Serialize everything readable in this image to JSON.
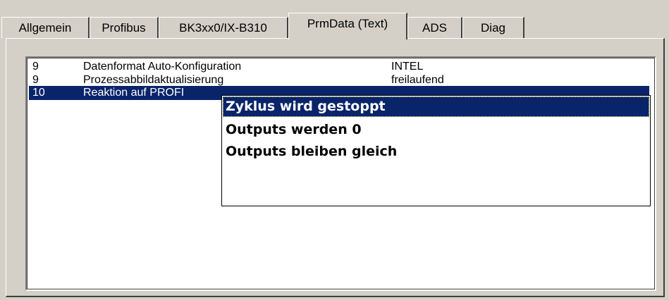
{
  "tabs": [
    {
      "label": "Allgemein"
    },
    {
      "label": "Profibus"
    },
    {
      "label": "BK3xx0/IX-B310"
    },
    {
      "label": "PrmData (Text)"
    },
    {
      "label": "ADS"
    },
    {
      "label": "Diag"
    }
  ],
  "active_tab": "PrmData (Text)",
  "list": {
    "rows": [
      {
        "num": "9",
        "name": "Datenformat Auto-Konfiguration",
        "value": "INTEL"
      },
      {
        "num": "9",
        "name": "Prozessabbildaktualisierung",
        "value": "freilaufend"
      },
      {
        "num": "10",
        "name": "Reaktion auf PROFI",
        "value": ""
      }
    ]
  },
  "dropdown": {
    "options": [
      {
        "label": "Zyklus wird gestoppt"
      },
      {
        "label": "Outputs werden 0"
      },
      {
        "label": "Outputs bleiben gleich"
      }
    ],
    "selected": "Zyklus wird gestoppt"
  },
  "colors": {
    "selection": "#0a246a",
    "window_bg": "#d4d0c8"
  }
}
